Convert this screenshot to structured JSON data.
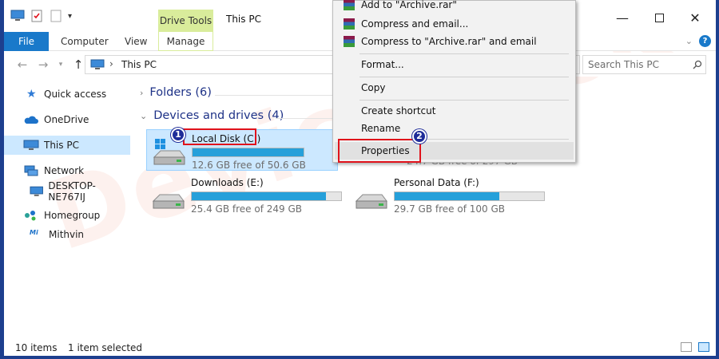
{
  "window": {
    "title": "This PC",
    "contextual_tab_group": "Drive Tools"
  },
  "ribbon": {
    "tabs": [
      "File",
      "Computer",
      "View",
      "Manage"
    ]
  },
  "address": {
    "path": "This PC",
    "search_placeholder": "Search This PC"
  },
  "nav": {
    "items": [
      "Quick access",
      "OneDrive",
      "This PC",
      "Network",
      "DESKTOP-NE767IJ",
      "Homegroup",
      "Mithvin"
    ],
    "selected": "This PC"
  },
  "content": {
    "groups": [
      {
        "label": "Folders (6)",
        "expanded": false
      },
      {
        "label": "Devices and drives (4)",
        "expanded": true
      }
    ],
    "drives": [
      {
        "name": "Local Disk (C:)",
        "free": "12.6 GB free of 50.6 GB",
        "used_fraction": 0.75,
        "selected": true
      },
      {
        "name": "Downloads (E:)",
        "free": "25.4 GB free of 249 GB",
        "used_fraction": 0.9
      },
      {
        "name": "Personal Data (F:)",
        "free": "29.7 GB free of 100 GB",
        "used_fraction": 0.7
      }
    ],
    "partial_drive_free": "24.7 GB free of 297 GB"
  },
  "status": {
    "items": "10 items",
    "selected": "1 item selected"
  },
  "context_menu": {
    "items": [
      {
        "label": "Add to \"Archive.rar\"",
        "icon": "winrar-icon"
      },
      {
        "label": "Compress and email...",
        "icon": "winrar-icon"
      },
      {
        "label": "Compress to \"Archive.rar\" and email",
        "icon": "winrar-icon"
      },
      {
        "label": "Format..."
      },
      {
        "label": "Copy"
      },
      {
        "label": "Create shortcut"
      },
      {
        "label": "Rename"
      },
      {
        "label": "Properties",
        "highlighted": true
      }
    ]
  },
  "callouts": [
    "1",
    "2"
  ],
  "watermark": "Devicetricks",
  "colors": {
    "file_tab": "#1979ca",
    "drive_tools": "#d9ec9b",
    "selection": "#cce8ff",
    "usage_bar": "#26a0da",
    "callout_red": "#e0121b",
    "badge_blue": "#1f2d99"
  }
}
